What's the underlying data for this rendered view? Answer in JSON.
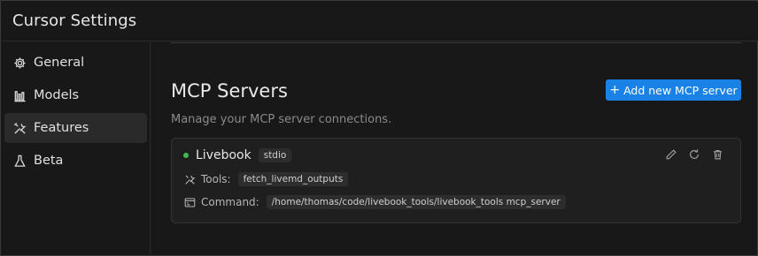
{
  "window": {
    "title": "Cursor Settings"
  },
  "sidebar": {
    "items": [
      {
        "label": "General",
        "icon": "gear-icon",
        "active": false
      },
      {
        "label": "Models",
        "icon": "chart-bars-icon",
        "active": false
      },
      {
        "label": "Features",
        "icon": "tools-icon",
        "active": true
      },
      {
        "label": "Beta",
        "icon": "flask-icon",
        "active": false
      }
    ]
  },
  "main": {
    "title": "MCP Servers",
    "add_button_label": "Add new MCP server",
    "subtitle": "Manage your MCP server connections."
  },
  "server": {
    "name": "Livebook",
    "transport": "stdio",
    "status_color": "#3fb950",
    "tools_label": "Tools:",
    "tools_value": "fetch_livemd_outputs",
    "command_label": "Command:",
    "command_value": "/home/thomas/code/livebook_tools/livebook_tools mcp_server",
    "actions": [
      "edit-icon",
      "refresh-icon",
      "trash-icon"
    ]
  },
  "colors": {
    "accent": "#1a82e6",
    "background": "#181818",
    "card": "#1f1f1f",
    "status_ok": "#3fb950"
  }
}
